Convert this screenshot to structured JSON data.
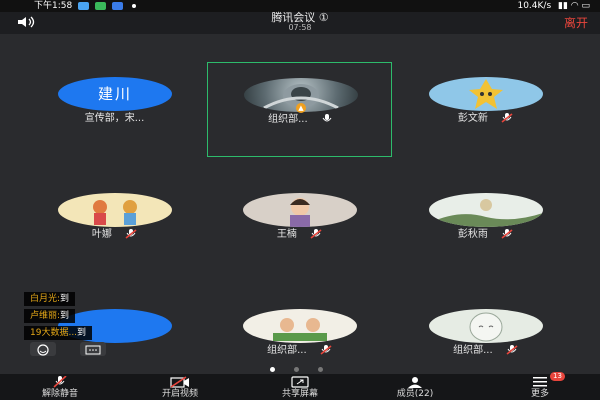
{
  "status_bar": {
    "time": "下午1:58",
    "net": "10.4K/s"
  },
  "header": {
    "title": "腾讯会议 ①",
    "timer": "07:58",
    "leave": "离开"
  },
  "participants": [
    {
      "name": "宣传部，宋...",
      "avatar_text": "建川",
      "avatar_color": "#1e78f0",
      "mic": "on",
      "active": false
    },
    {
      "name": "组织部...",
      "mic": "on",
      "active": true
    },
    {
      "name": "彭文新",
      "mic": "muted",
      "active": false
    },
    {
      "name": "叶娜",
      "mic": "muted",
      "active": false
    },
    {
      "name": "王楠",
      "mic": "muted",
      "active": false
    },
    {
      "name": "彭秋雨",
      "mic": "muted",
      "active": false
    },
    {
      "name": "",
      "mic": "none",
      "active": false
    },
    {
      "name": "组织部...",
      "mic": "muted",
      "active": false
    },
    {
      "name": "组织部...",
      "mic": "muted",
      "active": false
    }
  ],
  "chat": [
    {
      "who": "白月光:",
      "msg": "到"
    },
    {
      "who": "卢维丽:",
      "msg": "到"
    },
    {
      "who": "19大数据...",
      "msg": "到"
    }
  ],
  "toolbar": {
    "mute": "解除静音",
    "video": "开启视频",
    "share": "共享屏幕",
    "members": "成员(22)",
    "more": "更多",
    "more_badge": "13"
  },
  "colors": {
    "accent": "#2dbb6b",
    "danger": "#e8453c",
    "blue": "#1e78f0"
  }
}
